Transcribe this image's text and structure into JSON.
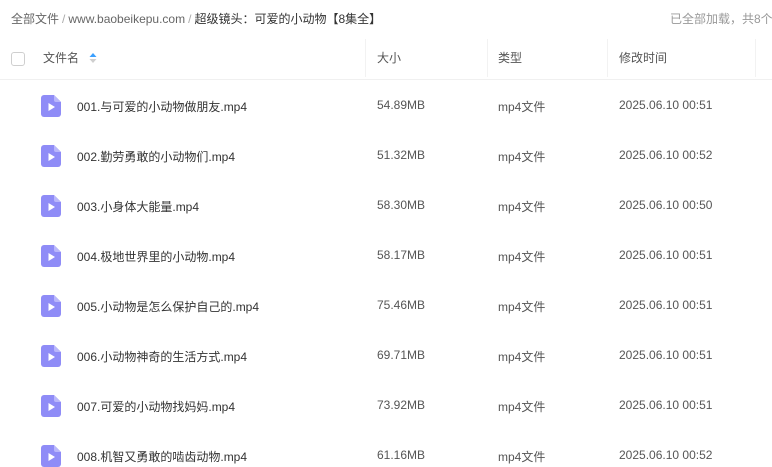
{
  "breadcrumb": {
    "root": "全部文件",
    "site": "www.baobeikepu.com",
    "current": "超级镜头：可爱的小动物【8集全】",
    "separator": "/"
  },
  "status": {
    "loaded_text": "已全部加载，共8个"
  },
  "table": {
    "columns": {
      "name": "文件名",
      "size": "大小",
      "type": "类型",
      "modified": "修改时间"
    },
    "rows": [
      {
        "name": "001.与可爱的小动物做朋友.mp4",
        "size": "54.89MB",
        "type": "mp4文件",
        "modified": "2025.06.10 00:51"
      },
      {
        "name": "002.勤劳勇敢的小动物们.mp4",
        "size": "51.32MB",
        "type": "mp4文件",
        "modified": "2025.06.10 00:52"
      },
      {
        "name": "003.小身体大能量.mp4",
        "size": "58.30MB",
        "type": "mp4文件",
        "modified": "2025.06.10 00:50"
      },
      {
        "name": "004.极地世界里的小动物.mp4",
        "size": "58.17MB",
        "type": "mp4文件",
        "modified": "2025.06.10 00:51"
      },
      {
        "name": "005.小动物是怎么保护自己的.mp4",
        "size": "75.46MB",
        "type": "mp4文件",
        "modified": "2025.06.10 00:51"
      },
      {
        "name": "006.小动物神奇的生活方式.mp4",
        "size": "69.71MB",
        "type": "mp4文件",
        "modified": "2025.06.10 00:51"
      },
      {
        "name": "007.可爱的小动物找妈妈.mp4",
        "size": "73.92MB",
        "type": "mp4文件",
        "modified": "2025.06.10 00:51"
      },
      {
        "name": "008.机智又勇敢的啮齿动物.mp4",
        "size": "61.16MB",
        "type": "mp4文件",
        "modified": "2025.06.10 00:52"
      }
    ]
  },
  "icons": {
    "file": "video-file-icon",
    "sort": "sort-icon"
  },
  "colors": {
    "video_icon": "#8f8cf7",
    "sort_active": "#3aa0ff",
    "divider": "#f0f0f0"
  }
}
